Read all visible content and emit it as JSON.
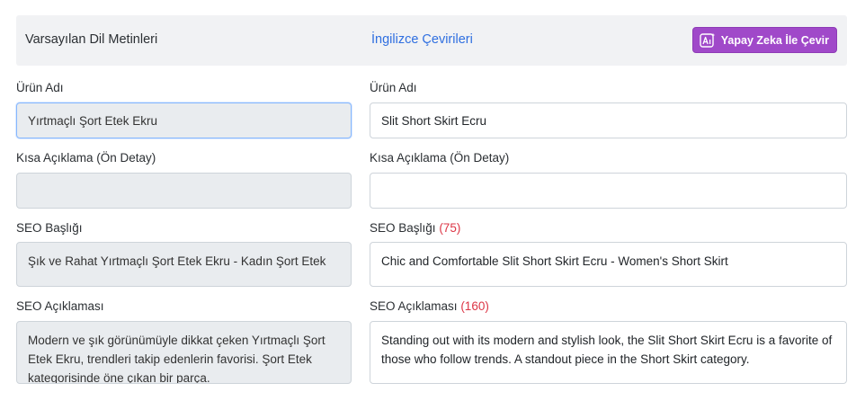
{
  "header": {
    "default_title": "Varsayılan Dil Metinleri",
    "translation_title": "İngilizce Çevirileri",
    "ai_button_label": "Yapay Zeka İle Çevir",
    "ai_icon": "ai-translate-icon"
  },
  "left": {
    "product_name_label": "Ürün Adı",
    "product_name_value": "Yırtmaçlı Şort Etek Ekru",
    "short_desc_label": "Kısa Açıklama (Ön Detay)",
    "short_desc_value": "",
    "seo_title_label": "SEO Başlığı",
    "seo_title_value": "Şık ve Rahat Yırtmaçlı Şort Etek Ekru - Kadın Şort Etek",
    "seo_desc_label": "SEO Açıklaması",
    "seo_desc_value": "Modern ve şık görünümüyle dikkat çeken Yırtmaçlı Şort Etek Ekru, trendleri takip edenlerin favorisi. Şort Etek kategorisinde öne çıkan bir parça."
  },
  "right": {
    "product_name_label": "Ürün Adı",
    "product_name_value": "Slit Short Skirt Ecru",
    "short_desc_label": "Kısa Açıklama (Ön Detay)",
    "short_desc_value": "",
    "seo_title_label": "SEO Başlığı",
    "seo_title_count": "(75)",
    "seo_title_value": "Chic and Comfortable Slit Short Skirt Ecru - Women's Short Skirt",
    "seo_desc_label": "SEO Açıklaması",
    "seo_desc_count": "(160)",
    "seo_desc_value": "Standing out with its modern and stylish look, the Slit Short Skirt Ecru is a favorite of those who follow trends. A standout piece in the Short Skirt category."
  },
  "colors": {
    "accent": "#a049c9",
    "link": "#2f6fe0",
    "counter": "#dc3545",
    "readonly_bg": "#e9ecef"
  }
}
